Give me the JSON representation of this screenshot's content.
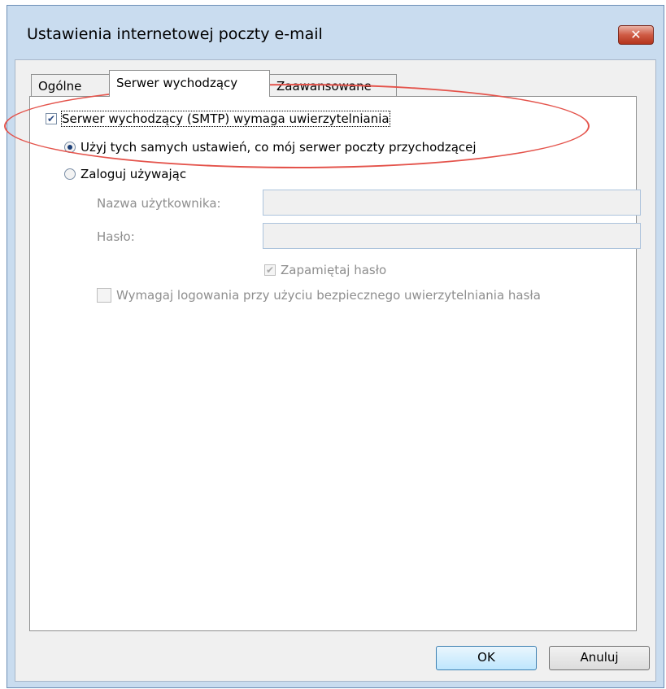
{
  "window": {
    "title": "Ustawienia internetowej poczty e-mail",
    "close_label": "✕"
  },
  "tabs": [
    {
      "label": "Ogólne",
      "active": false
    },
    {
      "label": "Serwer wychodzący",
      "active": true
    },
    {
      "label": "Zaawansowane",
      "active": false
    }
  ],
  "options": {
    "smtp_auth_label": "Serwer wychodzący (SMTP) wymaga uwierzytelniania",
    "smtp_auth_checked": true,
    "same_settings_label": "Użyj tych samych ustawień, co mój serwer poczty przychodzącej",
    "login_using_label": "Zaloguj używając",
    "username_label": "Nazwa użytkownika:",
    "username_value": "",
    "password_label": "Hasło:",
    "password_value": "",
    "remember_password_label": "Zapamiętaj hasło",
    "remember_password_checked": true,
    "spa_label": "Wymagaj logowania przy użyciu bezpiecznego uwierzytelniania hasła",
    "spa_checked": false
  },
  "buttons": {
    "ok": "OK",
    "cancel": "Anuluj"
  },
  "annotation_color": "#e4534b"
}
